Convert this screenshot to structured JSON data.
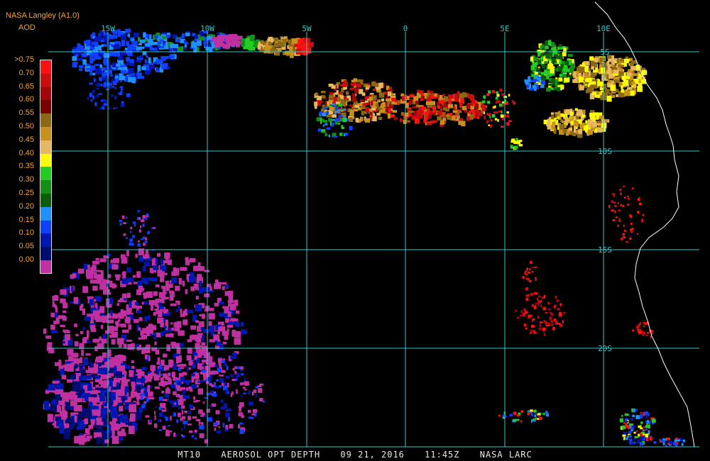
{
  "header": {
    "source": "NASA Langley (A1.0)",
    "product": "AOD"
  },
  "legend": {
    "labels": [
      ">0.75",
      "0.70",
      "0.65",
      "0.60",
      "0.55",
      "0.50",
      "0.45",
      "0.40",
      "0.35",
      "0.30",
      "0.25",
      "0.20",
      "0.15",
      "0.10",
      "0.05",
      "0.00"
    ],
    "colors": [
      "#ff1010",
      "#cc0d0d",
      "#a00808",
      "#7a0000",
      "#8b6914",
      "#c8901e",
      "#e8b860",
      "#ffff00",
      "#22cc22",
      "#158f15",
      "#0a5e0a",
      "#2090ff",
      "#1040ff",
      "#0018b0",
      "#000c70",
      "#c030a0"
    ]
  },
  "grid": {
    "lon_labels": [
      "15W",
      "10W",
      "5W",
      "0",
      "5E",
      "10E"
    ],
    "lat_labels": [
      "5S",
      "10S",
      "15S",
      "20S"
    ],
    "line_color": "#37c8c8"
  },
  "footer": {
    "product": "MT10",
    "title": "AEROSOL OPT DEPTH",
    "date": "09 21, 2016",
    "time": "11:45Z",
    "credit": "NASA LARC"
  }
}
